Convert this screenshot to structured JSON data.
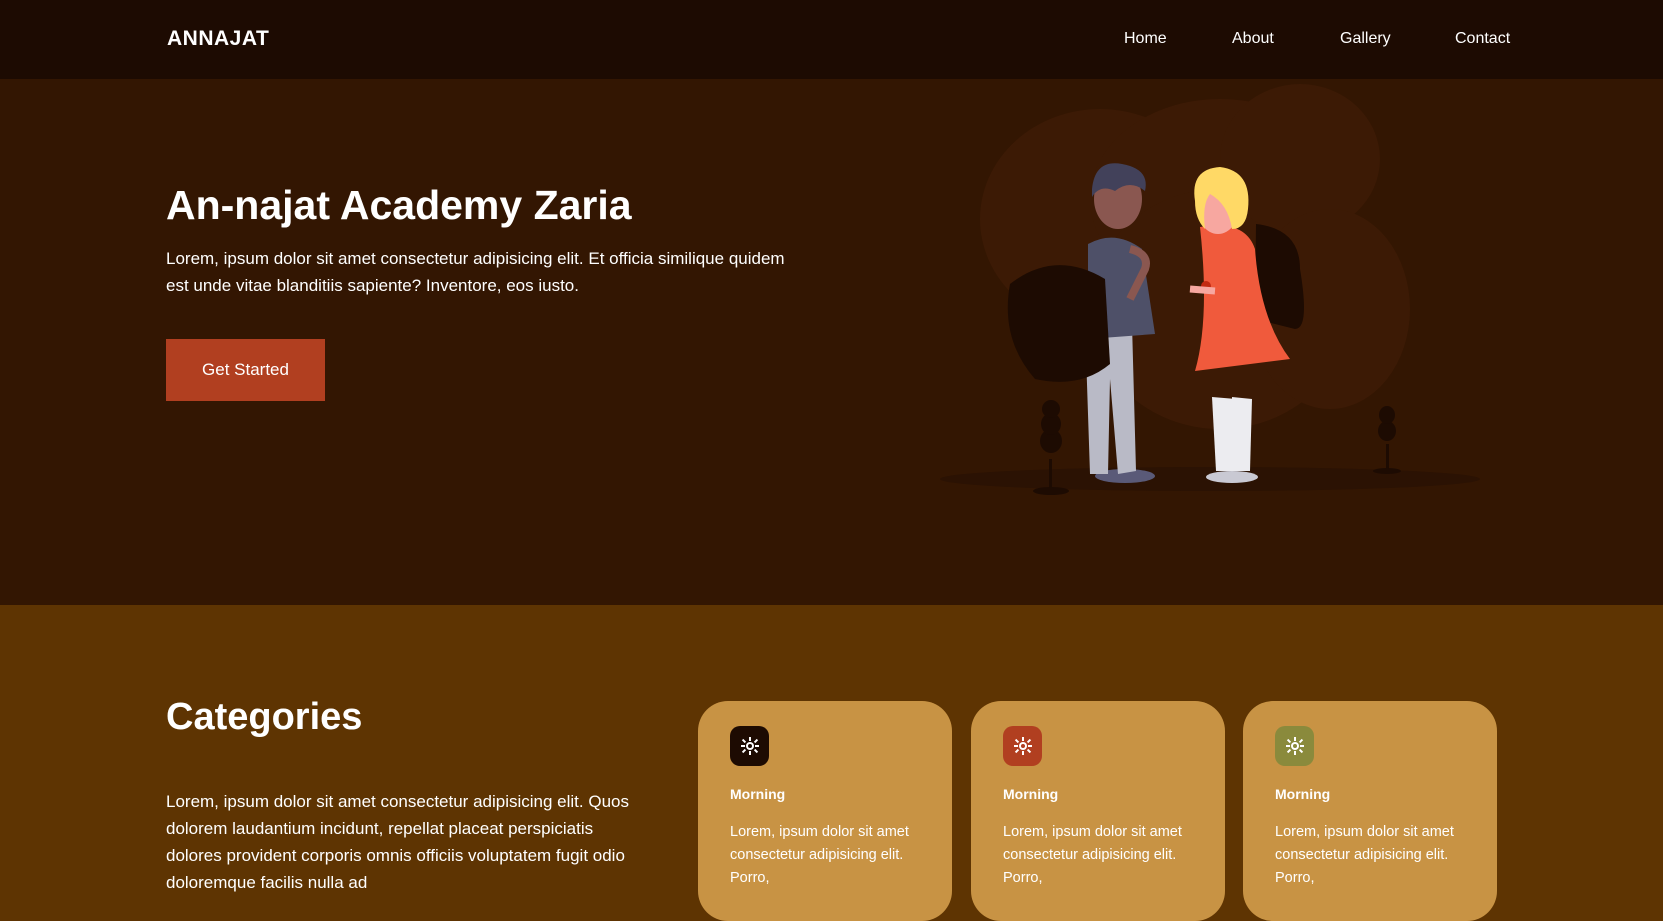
{
  "nav": {
    "brand": "ANNAJAT",
    "links": [
      "Home",
      "About",
      "Gallery",
      "Contact"
    ]
  },
  "hero": {
    "title": "An-najat Academy Zaria",
    "text": "Lorem, ipsum dolor sit amet consectetur adipisicing elit. Et officia similique quidem est unde vitae blanditiis sapiente? Inventore, eos iusto.",
    "cta_label": "Get Started",
    "illustration": "two-students-with-backpacks"
  },
  "categories": {
    "title": "Categories",
    "text": "Lorem, ipsum dolor sit amet consectetur adipisicing elit. Quos dolorem laudantium incidunt, repellat placeat perspiciatis dolores provident corporis omnis officiis voluptatem fugit odio doloremque facilis nulla ad",
    "cards": [
      {
        "title": "Morning",
        "text": "Lorem, ipsum dolor sit amet consectetur adipisicing elit. Porro,",
        "icon": "sun-icon",
        "icon_color": "#1d0b02"
      },
      {
        "title": "Morning",
        "text": "Lorem, ipsum dolor sit amet consectetur adipisicing elit. Porro,",
        "icon": "sun-icon",
        "icon_color": "#b13f20"
      },
      {
        "title": "Morning",
        "text": "Lorem, ipsum dolor sit amet consectetur adipisicing elit. Porro,",
        "icon": "sun-icon",
        "icon_color": "#8a8a3c"
      }
    ]
  },
  "colors": {
    "navbar": "#1d0b02",
    "hero_bg": "#331602",
    "categories_bg": "#5e3402",
    "accent": "#b13f20",
    "card_bg": "#c89344"
  }
}
